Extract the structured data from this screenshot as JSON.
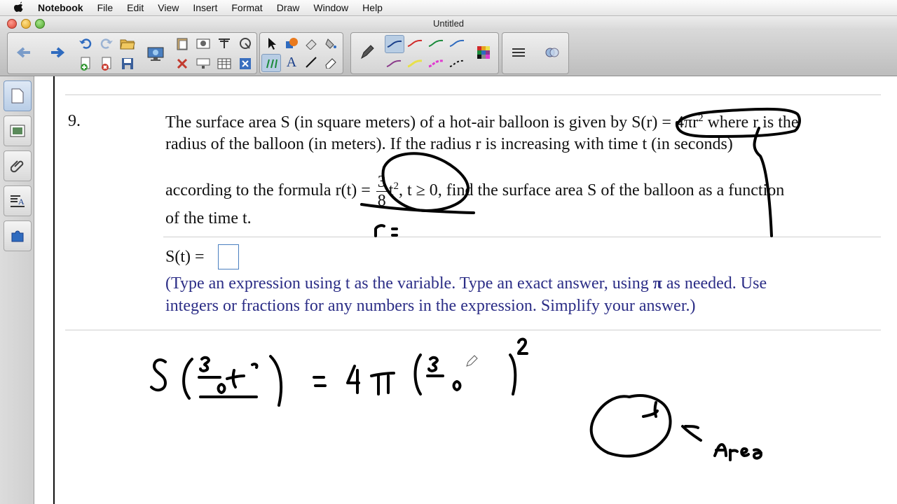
{
  "menubar": {
    "app_name": "Notebook",
    "items": [
      "File",
      "Edit",
      "View",
      "Insert",
      "Format",
      "Draw",
      "Window",
      "Help"
    ]
  },
  "window": {
    "title": "Untitled"
  },
  "toolbar": {
    "buttons": [
      "back-arrow",
      "forward-arrow",
      "undo",
      "redo",
      "open-folder",
      "add-page",
      "delete-page",
      "save",
      "screen-capture",
      "paste",
      "insert-picture",
      "insert-table-tool",
      "magic-pen",
      "delete",
      "screen-shade",
      "table",
      "close-box",
      "select-arrow",
      "shape",
      "eraser-fill",
      "fill",
      "pen-tool",
      "text",
      "line",
      "eraser",
      "pen-pencil",
      "pen-colors",
      "color-palette",
      "line-style",
      "transparency"
    ]
  },
  "sidebar": {
    "tabs": [
      "page-sorter",
      "gallery",
      "attachments",
      "properties",
      "addons"
    ]
  },
  "problem": {
    "number": "9.",
    "line1": "The surface area S (in square meters) of a hot-air balloon is given by S(r) = 4πr",
    "line1_sup": "2",
    "line1_end": " where r is the",
    "line2": "radius of the balloon (in meters).  If the radius r is increasing with time t (in seconds)",
    "line3_a": "according to the formula r(t) = ",
    "frac_num": "3",
    "frac_den": "8",
    "line3_b": "t",
    "line3_sup": "2",
    "line3_c": ", t ≥ 0, find the surface area S of the balloon as a function",
    "line4": "of the time t.",
    "answer_label": "S(t) =",
    "instructions_a": "(Type an expression using t as the variable.  Type an exact answer, using ",
    "instructions_pi": "π",
    "instructions_b": " as needed.   Use",
    "instructions_line2": "integers or fractions for any numbers in the expression.  Simplify your answer.)"
  },
  "handwriting": {
    "r_equals": "r =",
    "area_word": "Area"
  },
  "colors": {
    "instruction_text": "#2b2d86",
    "ink": "#000000",
    "answer_box": "#4a7fc0"
  }
}
